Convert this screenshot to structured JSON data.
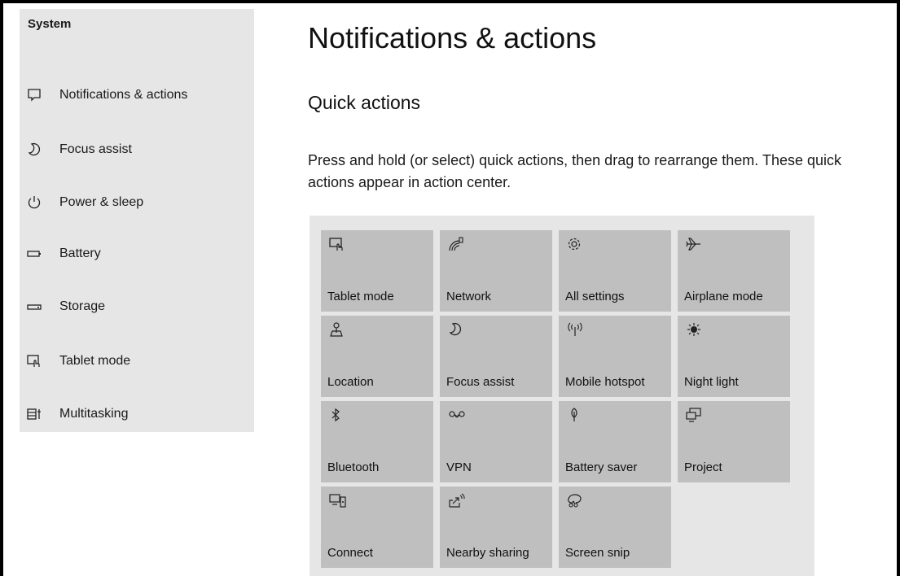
{
  "sidebar": {
    "heading": "System",
    "items": [
      {
        "label": "Notifications & actions",
        "icon": "notification-icon"
      },
      {
        "label": "Focus assist",
        "icon": "moon-icon"
      },
      {
        "label": "Power & sleep",
        "icon": "power-icon"
      },
      {
        "label": "Battery",
        "icon": "battery-icon"
      },
      {
        "label": "Storage",
        "icon": "storage-icon"
      },
      {
        "label": "Tablet mode",
        "icon": "tablet-mode-icon"
      },
      {
        "label": "Multitasking",
        "icon": "multitasking-icon"
      }
    ]
  },
  "main": {
    "title": "Notifications & actions",
    "section_title": "Quick actions",
    "description": "Press and hold (or select) quick actions, then drag to rearrange them. These quick actions appear in action center."
  },
  "quick_actions": [
    {
      "label": "Tablet mode",
      "icon": "tablet-mode-icon"
    },
    {
      "label": "Network",
      "icon": "network-icon"
    },
    {
      "label": "All settings",
      "icon": "gear-icon"
    },
    {
      "label": "Airplane mode",
      "icon": "airplane-icon"
    },
    {
      "label": "Location",
      "icon": "location-icon"
    },
    {
      "label": "Focus assist",
      "icon": "moon-icon"
    },
    {
      "label": "Mobile hotspot",
      "icon": "hotspot-icon"
    },
    {
      "label": "Night light",
      "icon": "sun-icon"
    },
    {
      "label": "Bluetooth",
      "icon": "bluetooth-icon"
    },
    {
      "label": "VPN",
      "icon": "vpn-icon"
    },
    {
      "label": "Battery saver",
      "icon": "leaf-icon"
    },
    {
      "label": "Project",
      "icon": "project-icon"
    },
    {
      "label": "Connect",
      "icon": "connect-icon"
    },
    {
      "label": "Nearby sharing",
      "icon": "share-icon"
    },
    {
      "label": "Screen snip",
      "icon": "snip-icon"
    }
  ]
}
